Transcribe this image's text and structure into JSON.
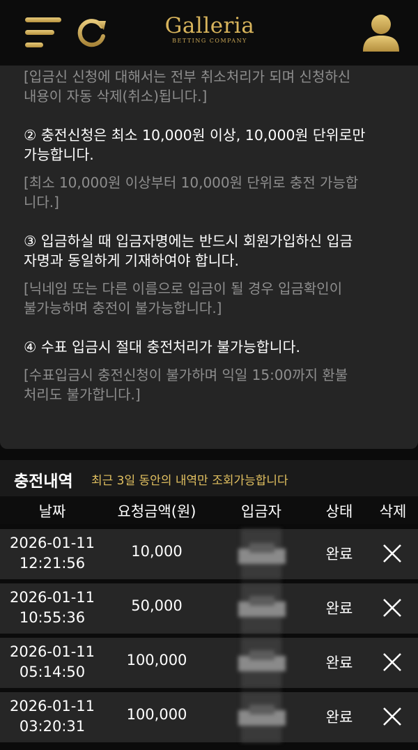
{
  "header": {
    "logo_title": "Galleria",
    "logo_subtitle": "BETTING COMPANY",
    "menu_icon": "hamburger-icon",
    "refresh_icon": "refresh-icon",
    "user_icon": "user-icon",
    "accent_color": "#d8b45c"
  },
  "notice": {
    "cut_line_1": "[입금신 신청에 대해서는 전부 취소처리가 되며 신청하신",
    "cut_line_2": "내용이 자동 삭제(취소)됩니다.]",
    "rule2_title_1": "② 충전신청은 최소 10,000원 이상, 10,000원 단위로만",
    "rule2_title_2": "가능합니다.",
    "rule2_hint_1": "[최소 10,000원 이상부터 10,000원 단위로 충전 가능합",
    "rule2_hint_2": "니다.]",
    "rule3_title_1": "③ 입금하실 때 입금자명에는 반드시 회원가입하신 입금",
    "rule3_title_2": "자명과 동일하게 기재하여야 합니다.",
    "rule3_hint_1": "[닉네임 또는 다른 이름으로 입금이 될 경우 입금확인이",
    "rule3_hint_2": "불가능하며 충전이 불가능합니다.]",
    "rule4_title_1": "④ 수표 입금시 절대 충전처리가 불가능합니다.",
    "rule4_hint_1": "[수표입금시 충전신청이 불가하며 익일 15:00까지 환불",
    "rule4_hint_2": "처리도 불가합니다.]"
  },
  "history": {
    "title": "충전내역",
    "note": "최근 3일 동안의 내역만 조회가능합니다",
    "columns": [
      "날짜",
      "요청금액(원)",
      "입금자",
      "상태",
      "삭제"
    ],
    "rows": [
      {
        "date": "2026-01-11",
        "time": "12:21:56",
        "amount": "10,000",
        "status": "완료",
        "delete_icon": "close-icon"
      },
      {
        "date": "2026-01-11",
        "time": "10:55:36",
        "amount": "50,000",
        "status": "완료",
        "delete_icon": "close-icon"
      },
      {
        "date": "2026-01-11",
        "time": "05:14:50",
        "amount": "100,000",
        "status": "완료",
        "delete_icon": "close-icon"
      },
      {
        "date": "2026-01-11",
        "time": "03:20:31",
        "amount": "100,000",
        "status": "완료",
        "delete_icon": "close-icon"
      }
    ]
  }
}
